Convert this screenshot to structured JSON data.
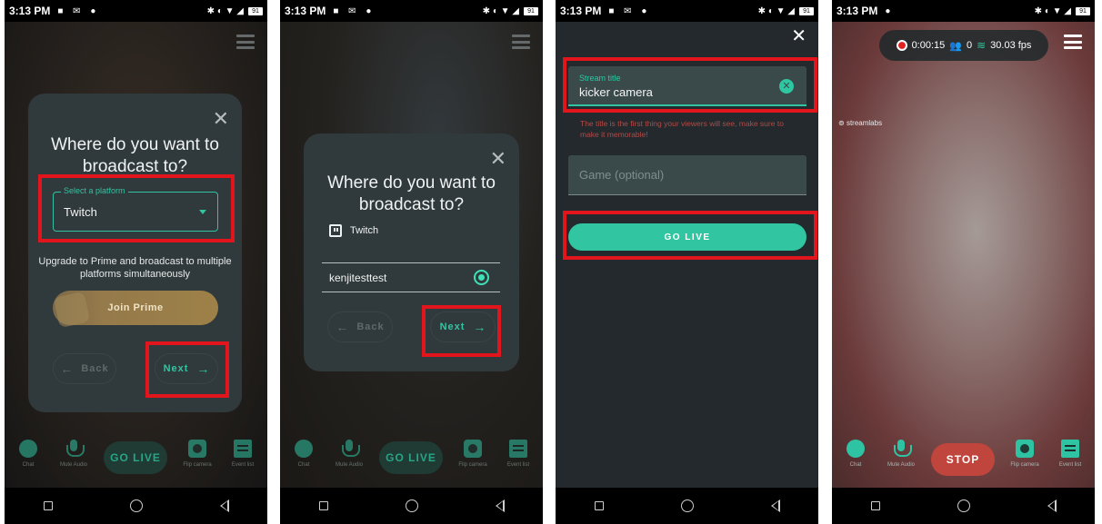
{
  "status_time": "3:13 PM",
  "screens": {
    "platform_select": {
      "title": "Where do you want to broadcast to?",
      "select_legend": "Select a platform",
      "select_value": "Twitch",
      "upgrade_text": "Upgrade to Prime and broadcast to multiple platforms simultaneously",
      "prime_label": "Join Prime",
      "back_label": "Back",
      "next_label": "Next"
    },
    "account_select": {
      "title": "Where do you want to broadcast to?",
      "platform_label": "Twitch",
      "account": "kenjitesttest",
      "back_label": "Back",
      "next_label": "Next"
    },
    "stream_details": {
      "title_label": "Stream title",
      "title_value": "kicker camera",
      "helper_text": "The title is the first thing your viewers will see, make sure to make it memorable!",
      "game_placeholder": "Game (optional)",
      "go_live_label": "GO LIVE"
    },
    "live": {
      "timer": "0:00:15",
      "viewers": "0",
      "fps": "30.03 fps",
      "watermark": "streamlabs",
      "stop_label": "STOP"
    }
  },
  "bottom_controls": {
    "chat": "Chat",
    "mute": "Mute Audio",
    "flip": "Flip camera",
    "events": "Event list",
    "go_live": "GO LIVE"
  },
  "highlight_color": "#e2151c",
  "accent_color": "#31c3a2"
}
